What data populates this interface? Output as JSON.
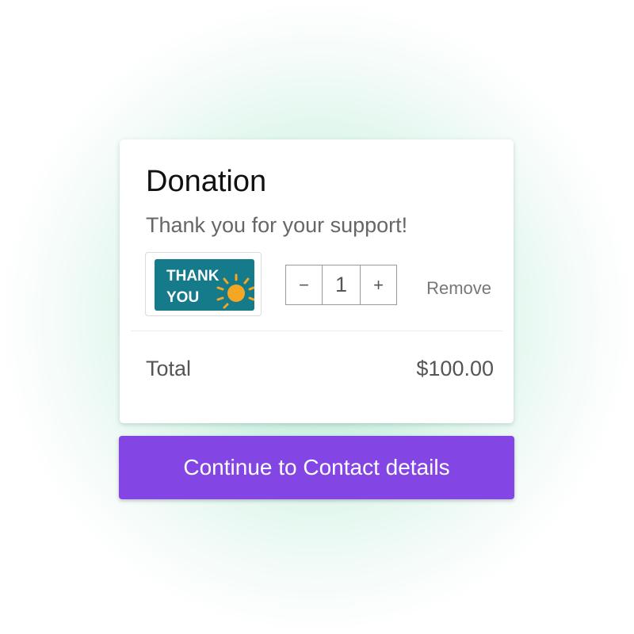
{
  "donation": {
    "title": "Donation",
    "subtitle": "Thank you for your support!",
    "item": {
      "image_alt": "thank-you-card-image",
      "image_text_line1": "THANK",
      "image_text_line2": "YOU",
      "quantity": "1",
      "decrement_label": "−",
      "increment_label": "+",
      "remove_label": "Remove"
    },
    "total_label": "Total",
    "total_value": "$100.00"
  },
  "continue_button": {
    "label": "Continue to Contact details"
  },
  "colors": {
    "accent": "#8345e3",
    "image_background": "#157a8a",
    "sun": "#f5a623"
  }
}
